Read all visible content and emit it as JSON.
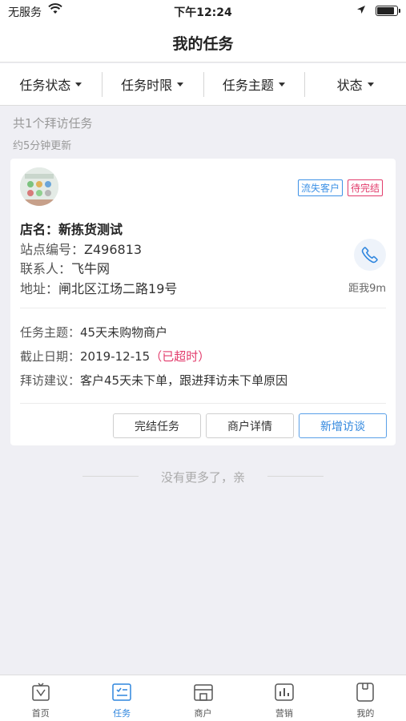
{
  "status_bar": {
    "carrier": "无服务",
    "time": "下午12:24"
  },
  "nav": {
    "title": "我的任务"
  },
  "filters": [
    {
      "label": "任务状态"
    },
    {
      "label": "任务时限"
    },
    {
      "label": "任务主题"
    },
    {
      "label": "状态"
    }
  ],
  "summary": {
    "count_text": "共1个拜访任务",
    "updated_text": "约5分钟更新"
  },
  "task": {
    "tags": {
      "lost": "流失客户",
      "pending": "待完结"
    },
    "shop_label": "店名：",
    "shop_name": "新拣货测试",
    "site_label": "站点编号：",
    "site_value": "Z496813",
    "contact_label": "联系人：",
    "contact_value": "飞牛网",
    "address_label": "地址：",
    "address_value": "闸北区江场二路19号",
    "distance": "距我9m",
    "topic_label": "任务主题：",
    "topic_value": "45天未购物商户",
    "deadline_label": "截止日期：",
    "deadline_value": "2019-12-15",
    "overdue": "（已超时）",
    "advice_label": "拜访建议：",
    "advice_value": "客户45天未下单，跟进拜访未下单原因",
    "buttons": {
      "complete": "完结任务",
      "detail": "商户详情",
      "add_visit": "新增访谈"
    }
  },
  "footer_note": "没有更多了，亲",
  "tabbar": [
    {
      "label": "首页",
      "icon": "home-icon",
      "active": false
    },
    {
      "label": "任务",
      "icon": "task-icon",
      "active": true
    },
    {
      "label": "商户",
      "icon": "shop-icon",
      "active": false
    },
    {
      "label": "营销",
      "icon": "marketing-icon",
      "active": false
    },
    {
      "label": "我的",
      "icon": "profile-icon",
      "active": false
    }
  ],
  "colors": {
    "accent": "#2f86de",
    "danger": "#e23b6b",
    "background": "#efeff4"
  }
}
